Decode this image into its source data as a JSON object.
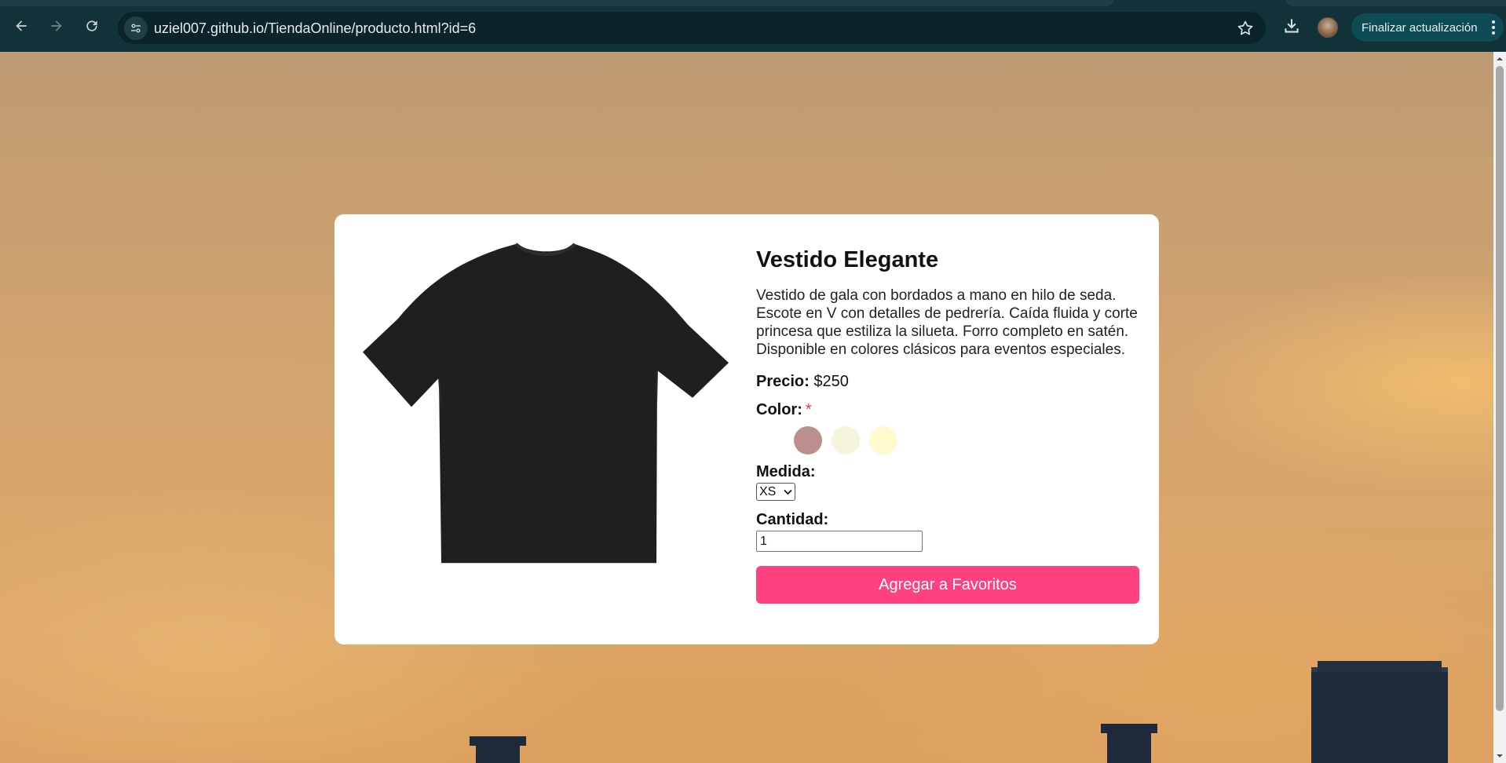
{
  "browser": {
    "url": "uziel007.github.io/TiendaOnline/producto.html?id=6",
    "update_label": "Finalizar actualización"
  },
  "product": {
    "title": "Vestido Elegante",
    "description": "Vestido de gala con bordados a mano en hilo de seda. Escote en V con detalles de pedrería. Caída fluida y corte princesa que estiliza la silueta. Forro completo en satén. Disponible en colores clásicos para eventos especiales.",
    "price_label": "Precio:",
    "price_value": "$250",
    "color_label": "Color:",
    "required_mark": "*",
    "colors": [
      "#ffffff",
      "#bc8f8f",
      "#f5f5dc",
      "#fffacd"
    ],
    "size_label": "Medida:",
    "size_selected": "XS",
    "quantity_label": "Cantidad:",
    "quantity_value": "1",
    "favorite_button": "Agregar a Favoritos"
  },
  "icons": {
    "back": "arrow-left-icon",
    "forward": "arrow-right-icon",
    "reload": "reload-icon",
    "site_info": "tune-icon",
    "bookmark": "star-icon",
    "download": "download-icon",
    "menu": "more-vert-icon"
  },
  "theme": {
    "accent": "#ff4081",
    "chrome_bg": "#123239"
  }
}
